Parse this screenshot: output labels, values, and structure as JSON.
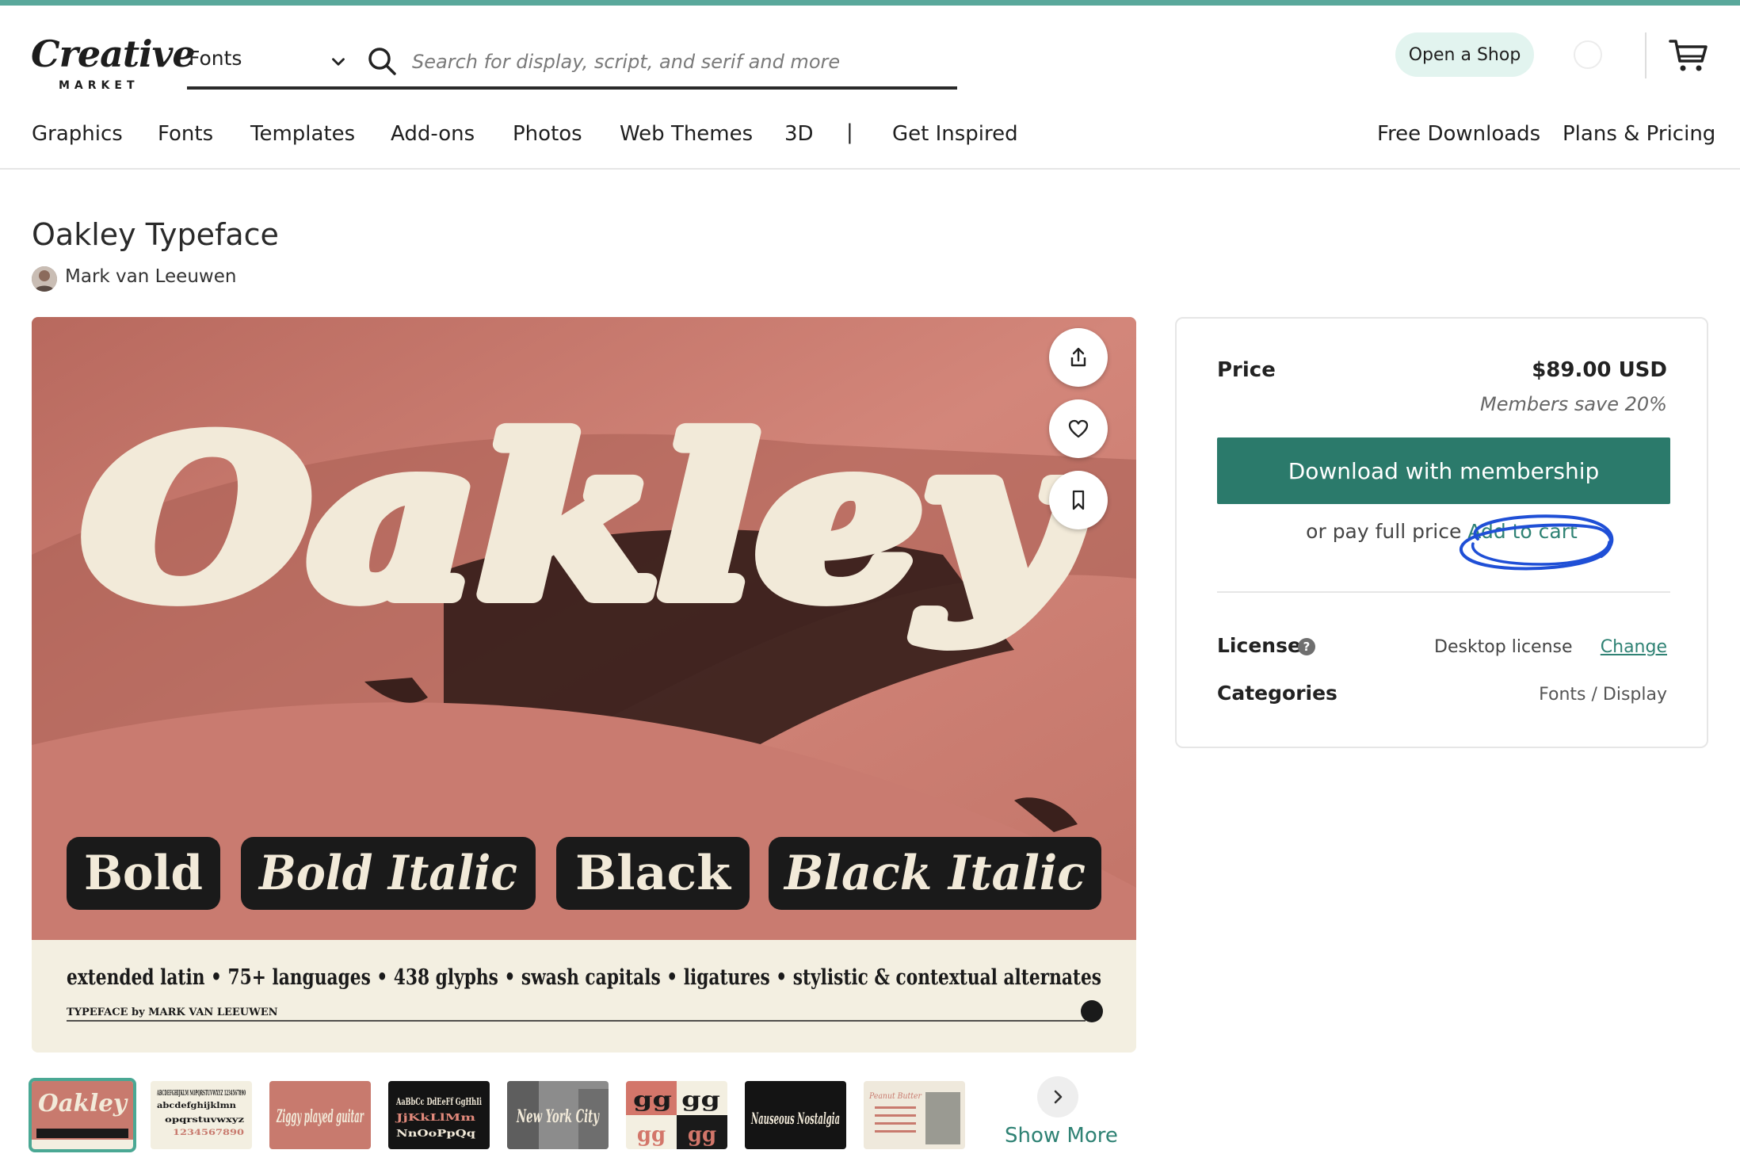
{
  "brand": {
    "logo_script": "Creative",
    "logo_sub": "MARKET",
    "accent_color": "#5aa89b",
    "button_color": "#2b7a6b",
    "link_color": "#2f8274"
  },
  "search": {
    "category": "Fonts",
    "placeholder": "Search for display, script, and serif and more",
    "value": ""
  },
  "header": {
    "open_shop_label": "Open a Shop",
    "cart_icon": "cart-icon"
  },
  "nav": {
    "left": [
      "Graphics",
      "Fonts",
      "Templates",
      "Add-ons",
      "Photos",
      "Web Themes",
      "3D"
    ],
    "separator": "|",
    "inspired": "Get Inspired",
    "right": [
      "Free Downloads",
      "Plans & Pricing"
    ]
  },
  "product": {
    "title": "Oakley Typeface",
    "author": "Mark van Leeuwen"
  },
  "hero": {
    "wordmark": "Oakley",
    "styles": [
      "Bold",
      "Bold Italic",
      "Black",
      "Black Italic"
    ],
    "features": "extended latin • 75+ languages • 438 glyphs • swash capitals • ligatures • stylistic & contextual alternates",
    "credit": "TYPEFACE by MARK VAN LEEUWEN",
    "actions": [
      "share-icon",
      "heart-icon",
      "bookmark-icon"
    ]
  },
  "thumbnails": {
    "items": [
      {
        "text": "Oakley",
        "style": "salmon"
      },
      {
        "text": "ABCDEFGHIJKLM NOPQRSTUVWXYZ 1234567890",
        "style": "cream"
      },
      {
        "text": "Ziggy played guitar",
        "style": "salmon-solid"
      },
      {
        "text": "AaBbCc DdEeFf GgHhIi",
        "style": "dark"
      },
      {
        "text": "New York City",
        "style": "photo"
      },
      {
        "text": "gg gg",
        "style": "grid"
      },
      {
        "text": "Nauseous Nostalgia",
        "style": "dark"
      },
      {
        "text": "Peanut Butter",
        "style": "cream-photo"
      }
    ],
    "show_more": "Show More"
  },
  "purchase": {
    "price_label": "Price",
    "price_value": "$89.00 USD",
    "members_save": "Members save 20%",
    "download_label": "Download with membership",
    "pay_text": "or pay full price",
    "add_to_cart": "Add to cart",
    "license_label": "License",
    "license_help": "?",
    "license_value": "Desktop license",
    "change_label": "Change",
    "categories_label": "Categories",
    "categories_value": "Fonts / Display"
  }
}
